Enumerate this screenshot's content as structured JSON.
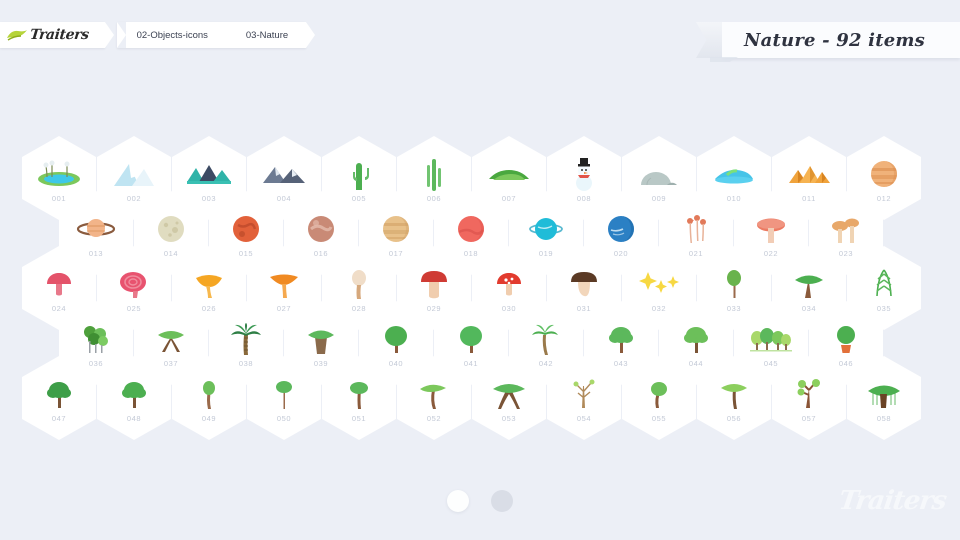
{
  "app": {
    "background_color": "#eceff6",
    "logo_text": "Traiters",
    "logo_icon": "leaf-swoosh-logo-icon",
    "watermark_text": "Traiters"
  },
  "breadcrumb": {
    "items": [
      {
        "label": "02-Objects-icons"
      },
      {
        "label": "03-Nature"
      }
    ]
  },
  "title_banner": {
    "text": "Nature - 92 items",
    "category": "Nature",
    "item_count": 92
  },
  "pagination": {
    "dots": [
      {
        "label": "1",
        "active": true
      },
      {
        "label": "2",
        "active": false
      }
    ]
  },
  "grid": {
    "rows": [
      {
        "offset": false,
        "cells": [
          {
            "label": "001",
            "icon": "oasis-pond-icon"
          },
          {
            "label": "002",
            "icon": "snowy-mountain-icon"
          },
          {
            "label": "003",
            "icon": "forest-mountain-range-icon"
          },
          {
            "label": "004",
            "icon": "grey-mountain-range-icon"
          },
          {
            "label": "005",
            "icon": "cactus-saguaro-icon"
          },
          {
            "label": "006",
            "icon": "tall-cactus-icon"
          },
          {
            "label": "007",
            "icon": "green-hill-icon"
          },
          {
            "label": "008",
            "icon": "snowman-icon"
          },
          {
            "label": "009",
            "icon": "igloo-icon"
          },
          {
            "label": "010",
            "icon": "tropical-island-icon"
          },
          {
            "label": "011",
            "icon": "pyramids-icon"
          },
          {
            "label": "012",
            "icon": "jupiter-planet-icon"
          }
        ]
      },
      {
        "offset": true,
        "cells": [
          {
            "label": "013",
            "icon": "saturn-planet-icon"
          },
          {
            "label": "014",
            "icon": "moon-planet-icon"
          },
          {
            "label": "015",
            "icon": "mars-planet-icon"
          },
          {
            "label": "016",
            "icon": "rocky-planet-icon"
          },
          {
            "label": "017",
            "icon": "venus-planet-icon"
          },
          {
            "label": "018",
            "icon": "red-planet-icon"
          },
          {
            "label": "019",
            "icon": "uranus-planet-icon"
          },
          {
            "label": "020",
            "icon": "neptune-planet-icon"
          },
          {
            "label": "021",
            "icon": "thin-mushrooms-icon"
          },
          {
            "label": "022",
            "icon": "red-flat-mushroom-icon"
          },
          {
            "label": "023",
            "icon": "twin-mushrooms-icon"
          }
        ]
      },
      {
        "offset": false,
        "cells": [
          {
            "label": "024",
            "icon": "pink-mushroom-icon"
          },
          {
            "label": "025",
            "icon": "spiral-mushroom-icon"
          },
          {
            "label": "026",
            "icon": "chanterelle-mushroom-icon"
          },
          {
            "label": "027",
            "icon": "orange-funnel-mushroom-icon"
          },
          {
            "label": "028",
            "icon": "slim-beige-mushroom-icon"
          },
          {
            "label": "029",
            "icon": "red-cap-mushroom-icon"
          },
          {
            "label": "030",
            "icon": "fly-agaric-mushroom-icon"
          },
          {
            "label": "031",
            "icon": "brown-porcini-mushroom-icon"
          },
          {
            "label": "032",
            "icon": "stars-sparkle-icon"
          },
          {
            "label": "033",
            "icon": "slim-tree-icon"
          },
          {
            "label": "034",
            "icon": "acacia-tree-icon"
          },
          {
            "label": "035",
            "icon": "conifer-sapling-icon"
          }
        ]
      },
      {
        "offset": true,
        "cells": [
          {
            "label": "036",
            "icon": "jungle-trees-icon"
          },
          {
            "label": "037",
            "icon": "bonsai-tree-icon"
          },
          {
            "label": "038",
            "icon": "palm-tree-icon"
          },
          {
            "label": "039",
            "icon": "baobab-tree-icon"
          },
          {
            "label": "040",
            "icon": "young-tree-icon"
          },
          {
            "label": "041",
            "icon": "round-tree-icon"
          },
          {
            "label": "042",
            "icon": "coconut-palm-icon"
          },
          {
            "label": "043",
            "icon": "leafy-tree-icon"
          },
          {
            "label": "044",
            "icon": "oak-tree-icon"
          },
          {
            "label": "045",
            "icon": "tree-row-icon"
          },
          {
            "label": "046",
            "icon": "potted-tree-icon"
          }
        ]
      },
      {
        "offset": false,
        "cells": [
          {
            "label": "047",
            "icon": "broadleaf-tree-icon"
          },
          {
            "label": "048",
            "icon": "bushy-tree-icon"
          },
          {
            "label": "049",
            "icon": "sapling-tree-icon"
          },
          {
            "label": "050",
            "icon": "thin-trunk-tree-icon"
          },
          {
            "label": "051",
            "icon": "small-canopy-tree-icon"
          },
          {
            "label": "052",
            "icon": "windswept-tree-icon"
          },
          {
            "label": "053",
            "icon": "savanna-tree-icon"
          },
          {
            "label": "054",
            "icon": "bare-branch-tree-icon"
          },
          {
            "label": "055",
            "icon": "curved-tree-icon"
          },
          {
            "label": "056",
            "icon": "umbrella-tree-icon"
          },
          {
            "label": "057",
            "icon": "sparse-tree-icon"
          },
          {
            "label": "058",
            "icon": "banyan-tree-icon"
          }
        ]
      }
    ]
  }
}
